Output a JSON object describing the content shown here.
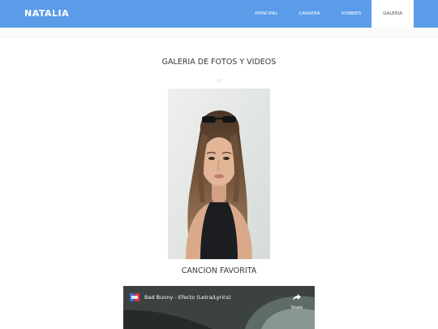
{
  "brand": "NATALIA",
  "nav": [
    {
      "label": "PRINCIPAL"
    },
    {
      "label": "CARRERA"
    },
    {
      "label": "HOBBIES"
    },
    {
      "label": "GALERIA",
      "active": true
    }
  ],
  "gallery": {
    "title": "GALERIA DE FOTOS Y VIDEOS",
    "subtitle": "YO"
  },
  "song": {
    "title": "CANCION FAVORITA",
    "video_title": "Bad Bunny - Efecto (Letra/Lyrics)",
    "share_label": "Share"
  },
  "colors": {
    "navbar": "#5b9ce8",
    "text": "#333a40"
  }
}
